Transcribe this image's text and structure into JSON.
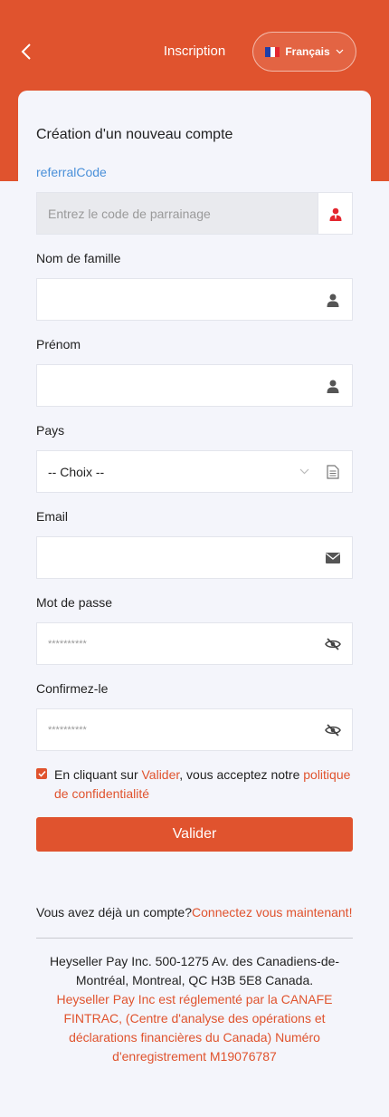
{
  "header": {
    "title": "Inscription",
    "language": "Français",
    "brand_color": "#e0532e"
  },
  "form": {
    "title": "Création d'un nouveau compte",
    "referral": {
      "label": "referralCode",
      "placeholder": "Entrez le code de parrainage"
    },
    "last_name": {
      "label": "Nom de famille",
      "value": ""
    },
    "first_name": {
      "label": "Prénom",
      "value": ""
    },
    "country": {
      "label": "Pays",
      "selected": "-- Choix --"
    },
    "email": {
      "label": "Email",
      "value": ""
    },
    "password": {
      "label": "Mot de passe",
      "placeholder": "**********"
    },
    "confirm": {
      "label": "Confirmez-le",
      "placeholder": "**********"
    },
    "consent": {
      "prefix": "En cliquant sur ",
      "valider": "Valider",
      "middle": ", vous acceptez notre ",
      "policy": "politique de confidentialité",
      "checked": true
    },
    "submit_label": "Valider"
  },
  "login": {
    "question": "Vous avez déjà un compte?",
    "link": "Connectez vous maintenant!"
  },
  "footer": {
    "address": "Heyseller Pay Inc. 500-1275 Av. des Canadiens-de-Montréal, Montreal, QC H3B 5E8 Canada.",
    "regulation": "Heyseller Pay Inc est réglementé par la CANAFE FINTRAC, (Centre d'analyse des opérations et déclarations financières du Canada) Numéro d'enregistrement M19076787"
  },
  "icons": {
    "back": "chevron-left-icon",
    "referral": "agent-icon",
    "person": "user-icon",
    "select": "chevron-down-icon",
    "list": "document-icon",
    "email": "envelope-icon",
    "password": "eye-slash-icon"
  }
}
